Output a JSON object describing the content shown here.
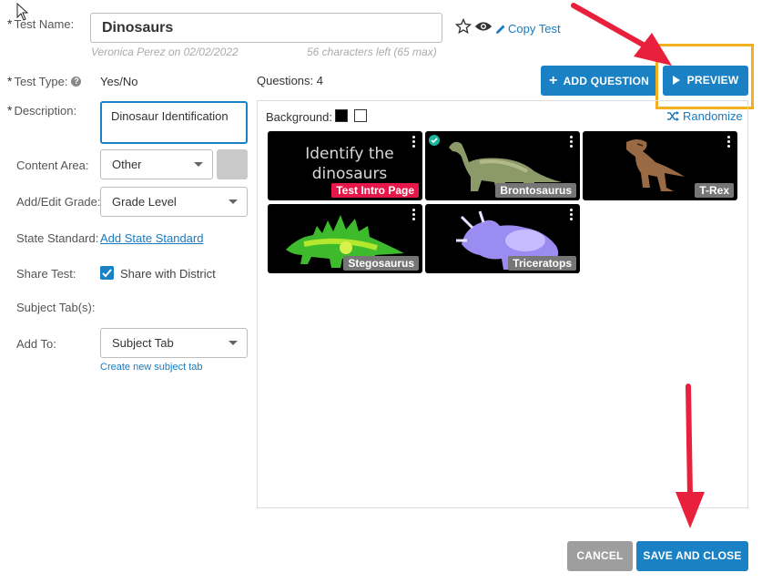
{
  "form": {
    "test_name_label": "Test Name:",
    "test_name_value": "Dinosaurs",
    "author_meta": "Veronica Perez on 02/02/2022",
    "chars_left": "56 characters left (65 max)",
    "copy_test": "Copy Test",
    "test_type_label": "Test Type:",
    "test_type_value": "Yes/No",
    "description_label": "Description:",
    "description_value": "Dinosaur Identification",
    "content_area_label": "Content Area:",
    "content_area_value": "Other",
    "grade_label": "Add/Edit Grade:",
    "grade_value": "Grade Level",
    "state_standard_label": "State Standard:",
    "state_standard_link": "Add State Standard",
    "share_label": "Share Test:",
    "share_option": "Share with District",
    "subject_tabs_label": "Subject Tab(s):",
    "add_to_label": "Add To:",
    "add_to_value": "Subject Tab",
    "create_subject_tab": "Create new subject tab"
  },
  "questions": {
    "count_label": "Questions: 4",
    "add_question": "ADD QUESTION",
    "preview": "PREVIEW",
    "background_label": "Background:",
    "randomize": "Randomize",
    "tiles": [
      {
        "label": "Test Intro Page",
        "title_text": "Identify the dinosaurs"
      },
      {
        "label": "Brontosaurus"
      },
      {
        "label": "T-Rex"
      },
      {
        "label": "Stegosaurus"
      },
      {
        "label": "Triceratops"
      }
    ]
  },
  "footer": {
    "cancel": "CANCEL",
    "save_close": "SAVE AND CLOSE"
  },
  "colors": {
    "accent": "#1a7bbf",
    "button_blue": "#1a82c4",
    "cancel_gray": "#9e9e9e",
    "intro_red": "#e8174a",
    "highlight_box": "#f2b01e",
    "arrow_red": "#e8203c"
  }
}
